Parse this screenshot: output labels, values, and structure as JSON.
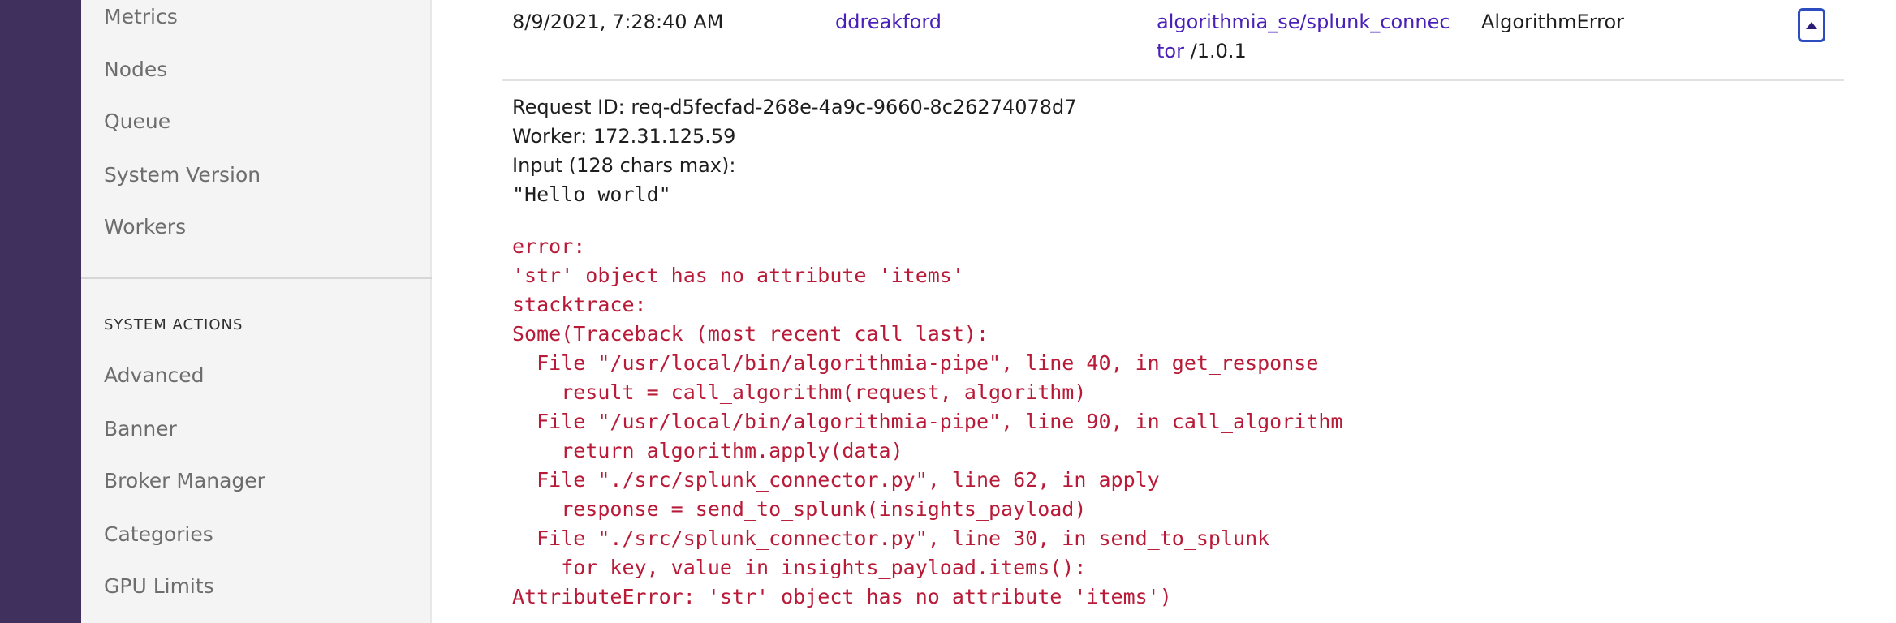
{
  "sidebar": {
    "items_top": [
      {
        "label": "Metrics"
      },
      {
        "label": "Nodes"
      },
      {
        "label": "Queue"
      },
      {
        "label": "System Version"
      },
      {
        "label": "Workers"
      }
    ],
    "section_title": "SYSTEM ACTIONS",
    "items_actions": [
      {
        "label": "Advanced"
      },
      {
        "label": "Banner"
      },
      {
        "label": "Broker Manager"
      },
      {
        "label": "Categories"
      },
      {
        "label": "GPU Limits"
      }
    ]
  },
  "row": {
    "timestamp": "8/9/2021, 7:28:40 AM",
    "user": "ddreakford",
    "algorithm": "algorithmia_se/splunk_connector",
    "version": "/1.0.1",
    "error_type": "AlgorithmError"
  },
  "details": {
    "request_id": "Request ID: req-d5fecfad-268e-4a9c-9660-8c26274078d7",
    "worker": "Worker: 172.31.125.59",
    "input_label": "Input (128 chars max):",
    "input_value": "\"Hello world\"",
    "error_text": "error:\n'str' object has no attribute 'items'\nstacktrace:\nSome(Traceback (most recent call last):\n  File \"/usr/local/bin/algorithmia-pipe\", line 40, in get_response\n    result = call_algorithm(request, algorithm)\n  File \"/usr/local/bin/algorithmia-pipe\", line 90, in call_algorithm\n    return algorithm.apply(data)\n  File \"./src/splunk_connector.py\", line 62, in apply\n    response = send_to_splunk(insights_payload)\n  File \"./src/splunk_connector.py\", line 30, in send_to_splunk\n    for key, value in insights_payload.items():\nAttributeError: 'str' object has no attribute 'items')"
  },
  "icons": {
    "collapse": "caret-up-icon"
  },
  "colors": {
    "rail": "#40305e",
    "link": "#4a21b8",
    "error": "#b81a37",
    "button_border": "#2c4cc0"
  }
}
